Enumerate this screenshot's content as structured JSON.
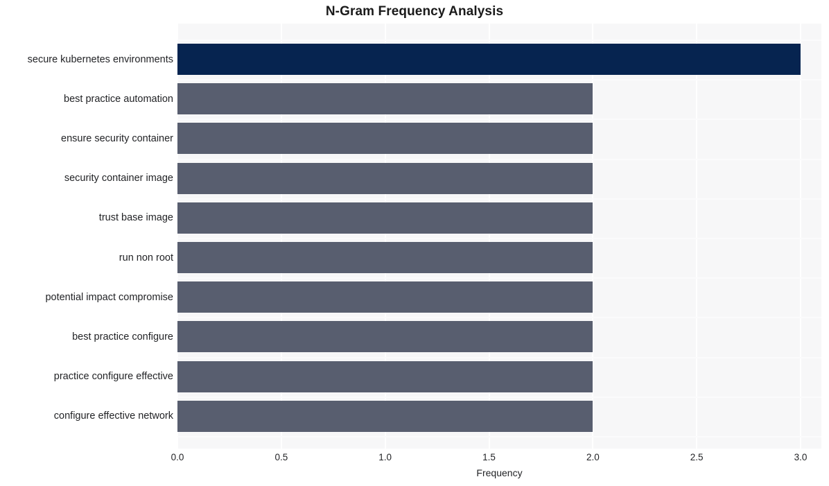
{
  "chart_data": {
    "type": "bar",
    "orientation": "horizontal",
    "title": "N-Gram Frequency Analysis",
    "xlabel": "Frequency",
    "ylabel": "",
    "xlim": [
      0.0,
      3.1
    ],
    "xticks": [
      "0.0",
      "0.5",
      "1.0",
      "1.5",
      "2.0",
      "2.5",
      "3.0"
    ],
    "xtick_values": [
      0.0,
      0.5,
      1.0,
      1.5,
      2.0,
      2.5,
      3.0
    ],
    "grid": true,
    "legend": "none",
    "categories": [
      "secure kubernetes environments",
      "best practice automation",
      "ensure security container",
      "security container image",
      "trust base image",
      "run non root",
      "potential impact compromise",
      "best practice configure",
      "practice configure effective",
      "configure effective network"
    ],
    "values": [
      3,
      2,
      2,
      2,
      2,
      2,
      2,
      2,
      2,
      2
    ],
    "bar_colors": [
      "#062450",
      "#585e6f",
      "#585e6f",
      "#585e6f",
      "#585e6f",
      "#585e6f",
      "#585e6f",
      "#585e6f",
      "#585e6f",
      "#585e6f"
    ],
    "plot_background": "#f7f7f8",
    "figure_background": "#ffffff",
    "gridline_color": "#ffffff",
    "highlight_color": "#062450",
    "bar_color": "#585e6f"
  }
}
